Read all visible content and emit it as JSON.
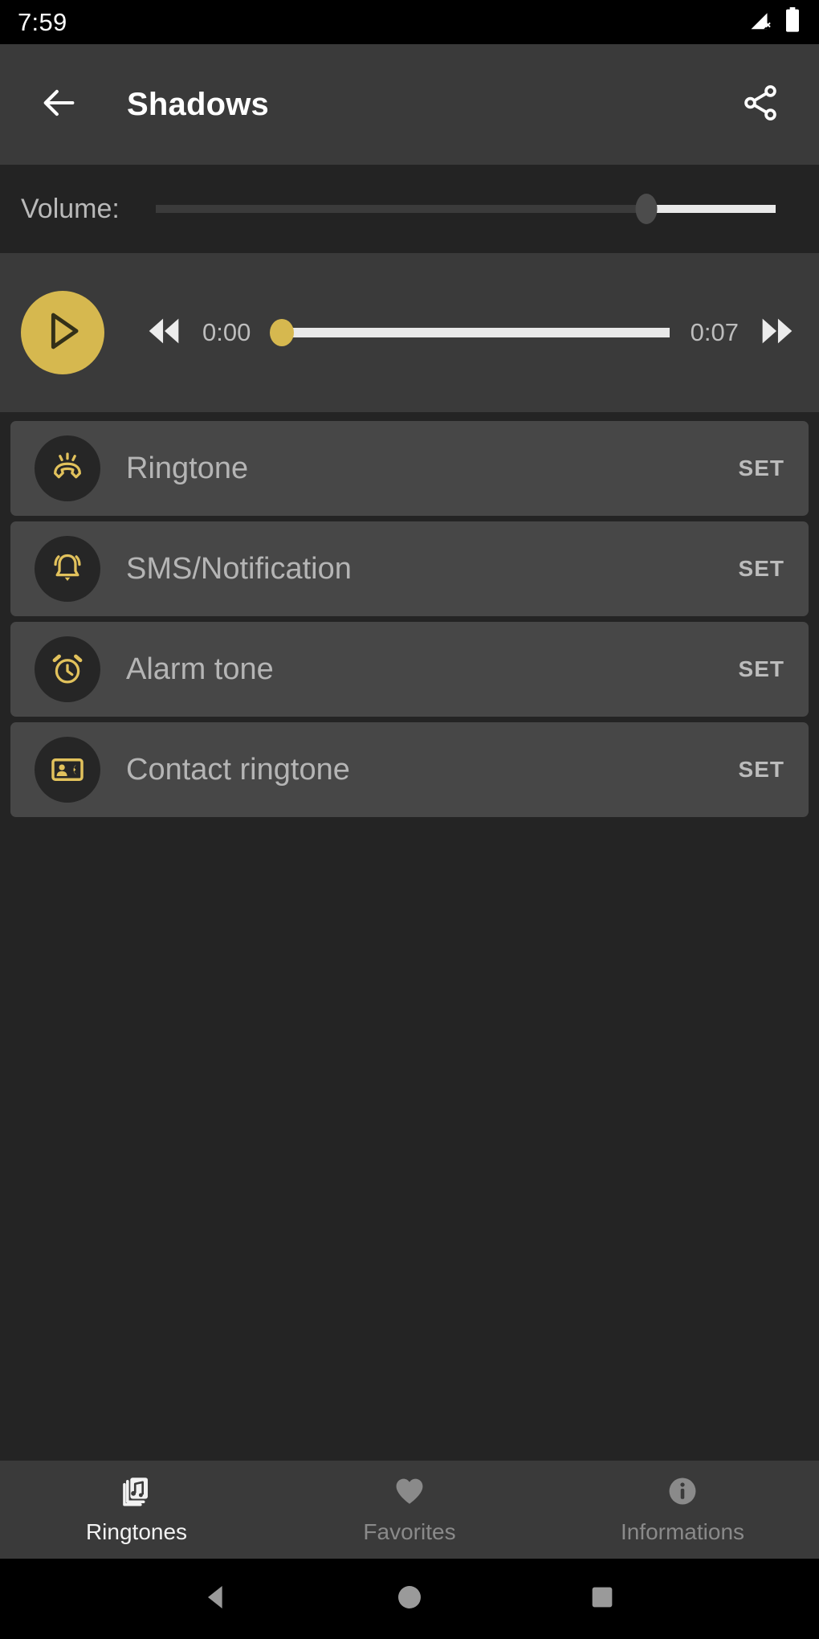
{
  "status_bar": {
    "time": "7:59",
    "icons": [
      "signal-no-service-icon",
      "battery-full-icon"
    ]
  },
  "app_bar": {
    "back_icon": "arrow-left-icon",
    "title": "Shadows",
    "share_icon": "share-icon"
  },
  "volume": {
    "label": "Volume:",
    "value_percent": 79
  },
  "player": {
    "play_icon": "play-icon",
    "rewind_icon": "rewind-icon",
    "forward_icon": "fast-forward-icon",
    "current_time": "0:00",
    "total_time": "0:07",
    "progress_percent": 0
  },
  "ringtone_actions": [
    {
      "icon": "phone-ringing-icon",
      "label": "Ringtone",
      "action": "SET"
    },
    {
      "icon": "bell-ringing-icon",
      "label": "SMS/Notification",
      "action": "SET"
    },
    {
      "icon": "alarm-clock-icon",
      "label": "Alarm tone",
      "action": "SET"
    },
    {
      "icon": "contact-card-phone-icon",
      "label": "Contact ringtone",
      "action": "SET"
    }
  ],
  "bottom_nav": [
    {
      "icon": "music-cards-icon",
      "label": "Ringtones",
      "active": true
    },
    {
      "icon": "heart-icon",
      "label": "Favorites",
      "active": false
    },
    {
      "icon": "info-circle-icon",
      "label": "Informations",
      "active": false
    }
  ],
  "system_nav": {
    "back": "nav-back-triangle-icon",
    "home": "nav-home-circle-icon",
    "recents": "nav-recents-square-icon"
  },
  "colors": {
    "accent_gold": "#d6b84f",
    "appbar_bg": "#3a3a3a",
    "page_bg": "#242424",
    "card_bg": "#474747",
    "icon_circle_bg": "#262626",
    "text_primary": "#f2f2f2",
    "text_secondary": "#b5b5b5",
    "text_muted": "#8a8a8a"
  }
}
